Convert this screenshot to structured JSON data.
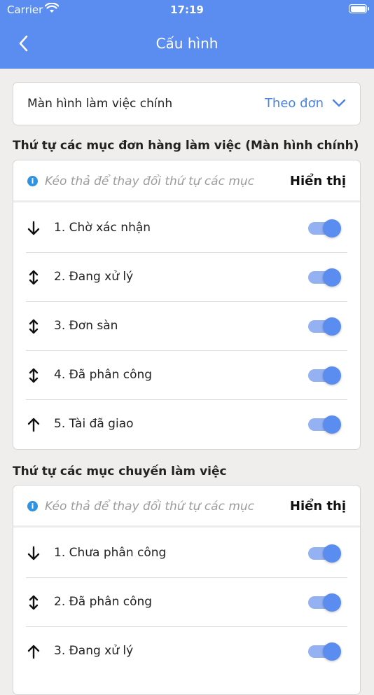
{
  "status_bar": {
    "carrier": "Carrier",
    "time": "17:19"
  },
  "header": {
    "title": "Cấu hình"
  },
  "main_screen": {
    "label": "Màn hình làm việc chính",
    "value": "Theo đơn"
  },
  "sections": [
    {
      "title": "Thứ tự các mục đơn hàng làm việc (Màn hình chính)",
      "hint": "Kéo thả để thay đổi thứ tự các mục",
      "show_label": "Hiển thị",
      "items": [
        {
          "label": "1. Chờ xác nhận",
          "arrow": "down-arrow-icon",
          "enabled": true
        },
        {
          "label": "2. Đang xử lý",
          "arrow": "up-down-arrow-icon",
          "enabled": true
        },
        {
          "label": "3. Đơn sàn",
          "arrow": "up-down-arrow-icon",
          "enabled": true
        },
        {
          "label": "4. Đã phân công",
          "arrow": "up-down-arrow-icon",
          "enabled": true
        },
        {
          "label": "5. Tài đã giao",
          "arrow": "up-arrow-icon",
          "enabled": true
        }
      ]
    },
    {
      "title": "Thứ tự các mục chuyến làm việc",
      "hint": "Kéo thả để thay đổi thứ tự các mục",
      "show_label": "Hiển thị",
      "items": [
        {
          "label": "1. Chưa phân công",
          "arrow": "down-arrow-icon",
          "enabled": true
        },
        {
          "label": "2. Đã phân công",
          "arrow": "up-down-arrow-icon",
          "enabled": true
        },
        {
          "label": "3. Đang xử lý",
          "arrow": "up-arrow-icon",
          "enabled": true
        }
      ]
    }
  ],
  "colors": {
    "primary": "#5b8df0",
    "link": "#4a83e8",
    "toggle_track": "#94b1f2",
    "info": "#2f93e0"
  }
}
